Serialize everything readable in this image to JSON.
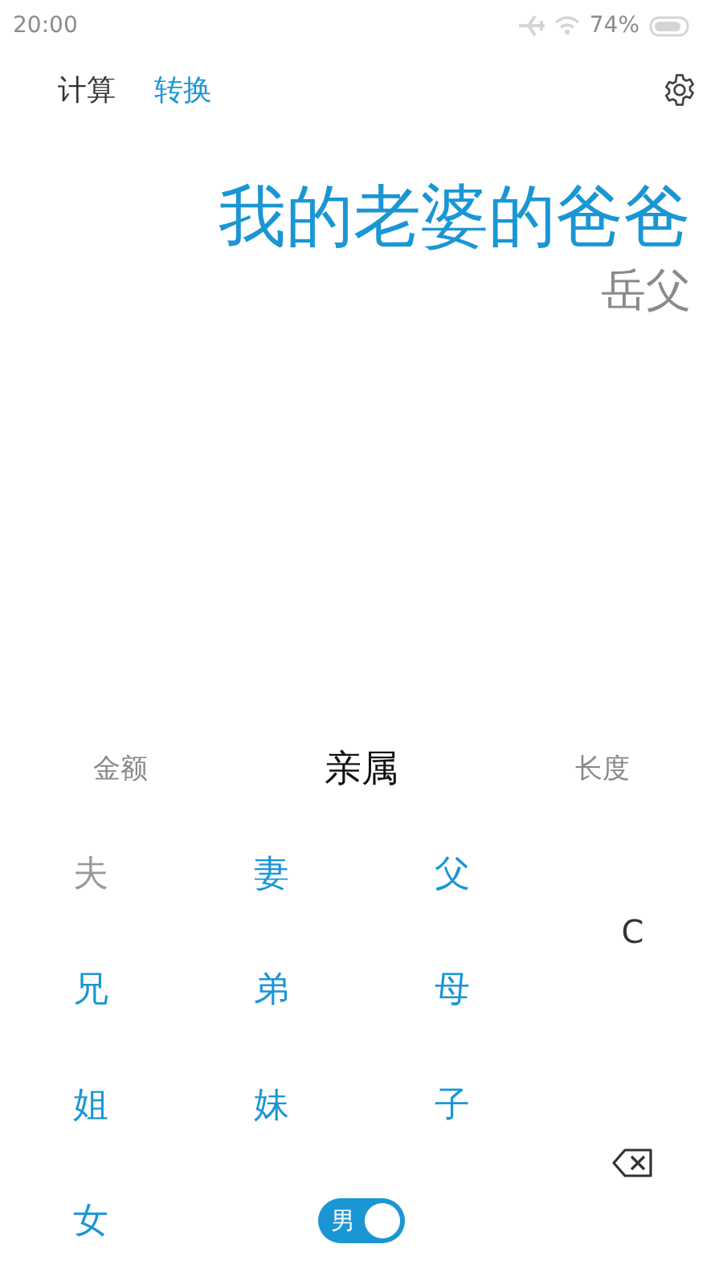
{
  "status_bar": {
    "time": "20:00",
    "battery": "74%"
  },
  "tabs": [
    {
      "label": "计算",
      "selected": false
    },
    {
      "label": "转换",
      "selected": true
    }
  ],
  "display": {
    "expression": "我的老婆的爸爸",
    "result": "岳父"
  },
  "categories": [
    {
      "label": "金额",
      "selected": false
    },
    {
      "label": "亲属",
      "selected": true
    },
    {
      "label": "长度",
      "selected": false
    }
  ],
  "keys": [
    {
      "label": "夫",
      "disabled": true
    },
    {
      "label": "妻",
      "disabled": false
    },
    {
      "label": "父",
      "disabled": false
    },
    {
      "label": "兄",
      "disabled": false
    },
    {
      "label": "弟",
      "disabled": false
    },
    {
      "label": "母",
      "disabled": false
    },
    {
      "label": "姐",
      "disabled": false
    },
    {
      "label": "妹",
      "disabled": false
    },
    {
      "label": "子",
      "disabled": false
    },
    {
      "label": "女",
      "disabled": false
    }
  ],
  "clear_key": "C",
  "gender_toggle": {
    "label": "男",
    "on": true
  }
}
